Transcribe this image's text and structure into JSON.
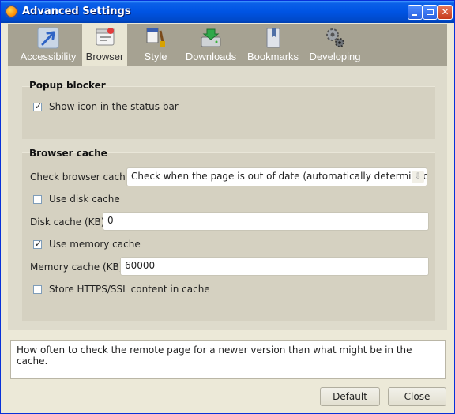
{
  "window": {
    "title": "Advanced Settings"
  },
  "tabs": [
    {
      "label": "Accessibility",
      "icon": "arrow-pointer-icon"
    },
    {
      "label": "Browser",
      "icon": "browser-icon"
    },
    {
      "label": "Style",
      "icon": "brush-icon"
    },
    {
      "label": "Downloads",
      "icon": "download-drive-icon"
    },
    {
      "label": "Bookmarks",
      "icon": "bookmark-book-icon"
    },
    {
      "label": "Developing",
      "icon": "gears-icon"
    }
  ],
  "active_tab": "Browser",
  "popup_blocker": {
    "title": "Popup blocker",
    "show_icon_label": "Show icon in the status bar",
    "show_icon_checked": true
  },
  "browser_cache": {
    "title": "Browser cache",
    "check_label": "Check browser cache",
    "check_value": "Check when the page is out of date (automatically determined)",
    "use_disk_label": "Use disk cache",
    "use_disk_checked": false,
    "disk_cache_label": "Disk cache (KB)",
    "disk_cache_value": "0",
    "use_memory_label": "Use memory cache",
    "use_memory_checked": true,
    "memory_cache_label": "Memory cache (KB)",
    "memory_cache_value": "60000",
    "store_https_label": "Store HTTPS/SSL content in cache",
    "store_https_checked": false
  },
  "description": "How often to check the remote page for a newer version than what might be in the cache.",
  "buttons": {
    "default": "Default",
    "close": "Close"
  },
  "colors": {
    "title_bar": "#0054e3",
    "toolbar": "#a6a292",
    "active_tab": "#e9e6d4",
    "panel": "#dedbcc"
  }
}
